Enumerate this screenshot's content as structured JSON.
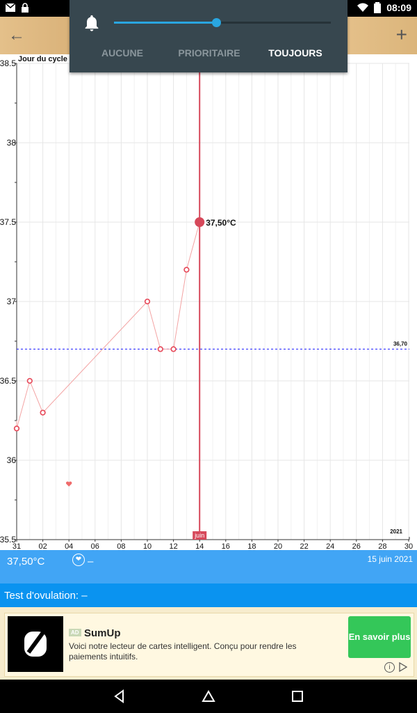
{
  "status": {
    "time": "08:09"
  },
  "notification": {
    "volume_level": 0.47,
    "options": [
      {
        "label": "AUCUNE",
        "active": false
      },
      {
        "label": "PRIORITAIRE",
        "active": false
      },
      {
        "label": "TOUJOURS",
        "active": true
      }
    ]
  },
  "chart_data": {
    "type": "line",
    "ylabel": "Jour du cycle",
    "ylim": [
      35.5,
      38.5
    ],
    "yticks": [
      "38.5",
      "38",
      "37.5",
      "37",
      "36.5",
      "36",
      "35.5"
    ],
    "xticks": [
      "31",
      "02",
      "04",
      "06",
      "08",
      "10",
      "12",
      "14",
      "16",
      "18",
      "20",
      "22",
      "24",
      "26",
      "28",
      "30"
    ],
    "x_day_index": [
      0,
      2,
      4,
      6,
      8,
      10,
      12,
      14,
      16,
      18,
      20,
      22,
      24,
      26,
      28,
      30
    ],
    "series": [
      {
        "points": [
          [
            -1,
            36.25
          ],
          [
            0,
            36.2
          ],
          [
            1,
            36.5
          ],
          [
            2,
            36.3
          ],
          [
            10,
            37.0
          ],
          [
            11,
            36.7
          ],
          [
            12,
            36.7
          ],
          [
            13,
            37.2
          ],
          [
            14,
            37.5
          ]
        ]
      }
    ],
    "coverline": {
      "value": 36.7,
      "label": "36,70"
    },
    "selected": {
      "day": 14,
      "value": 37.5,
      "label": "37,50°C",
      "month_tag": "juin"
    },
    "heart_marker": {
      "day": 4,
      "value": 35.85
    },
    "year_label": "2021",
    "colors": {
      "line": "#f3a3a3",
      "marker": "#e74c5c",
      "selected": "#d6485a",
      "coverline": "#1a1aff"
    }
  },
  "summary": {
    "temperature": "37,50°C",
    "mucus": "–",
    "date": "15 juin 2021"
  },
  "ovulation": {
    "text": "Test d'ovulation: –"
  },
  "ad": {
    "tag": "AD",
    "brand": "SumUp",
    "description": "Voici notre lecteur de cartes intelligent. Conçu pour rendre les paiements intuitifs.",
    "cta": "En savoir plus"
  }
}
